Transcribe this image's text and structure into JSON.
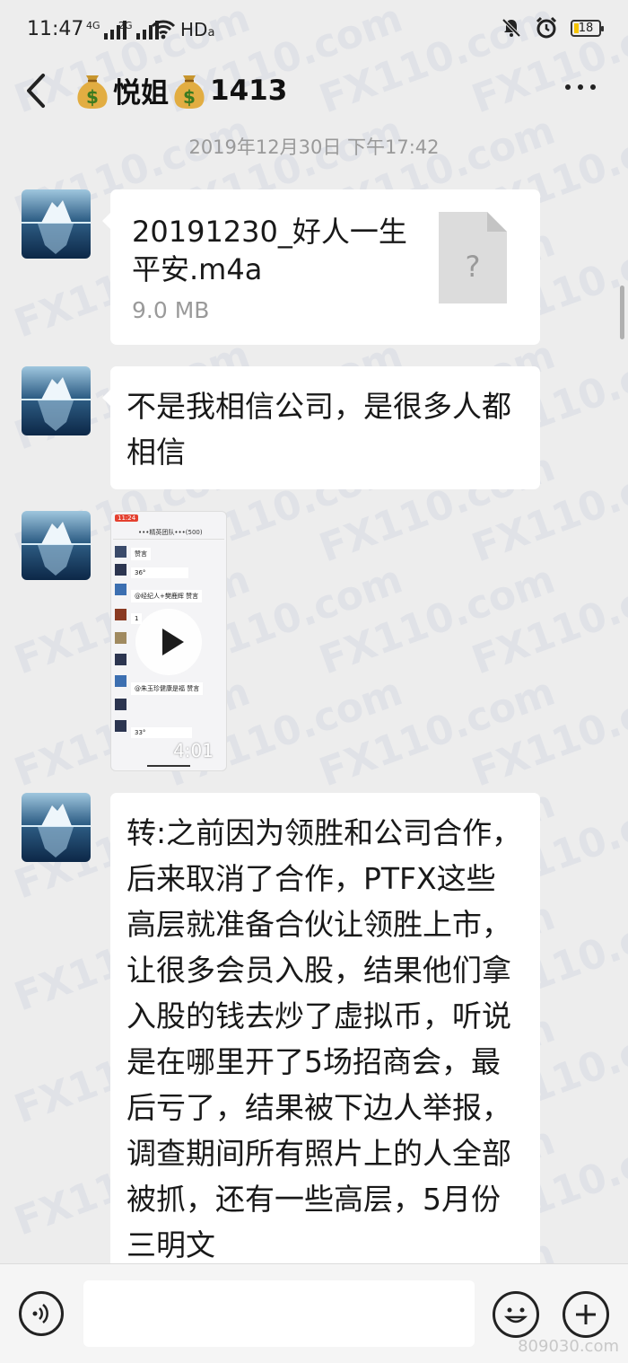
{
  "status_bar": {
    "time": "11:47",
    "signal1_label": "4G",
    "signal2_label": "2G",
    "network": "HD",
    "battery_level": "18",
    "icons": [
      "mute-icon",
      "alarm-icon",
      "wifi-icon",
      "battery-icon"
    ]
  },
  "header": {
    "title_name": "悦姐",
    "title_suffix": "1413",
    "title_emoji": "money-bag-icon",
    "back_icon": "chevron-left-icon",
    "more_icon": "more-dots-icon"
  },
  "chat": {
    "timestamp": "2019年12月30日 下午17:42",
    "messages": [
      {
        "type": "file",
        "file_name": "20191230_好人一生平安.m4a",
        "file_size": "9.0 MB",
        "icon": "unknown-file-icon"
      },
      {
        "type": "text",
        "text": "不是我相信公司，是很多人都相信"
      },
      {
        "type": "video",
        "duration": "4:01",
        "thumbnail": {
          "time": "11:24",
          "header": "•••精英团队•••(500)",
          "lines": [
            "赞言",
            "36°",
            "@经纪人+樊鹿辉 赞言",
            "1",
            "@朱玉珍健康是福 赞言",
            "33°"
          ]
        }
      },
      {
        "type": "text",
        "text": "转:之前因为领胜和公司合作，后来取消了合作，PTFX这些高层就准备合伙让领胜上市，让很多会员入股，结果他们拿入股的钱去炒了虚拟币，听说是在哪里开了5场招商会，最后亏了，结果被下边人举报，调查期间所有照片上的人全部被抓，还有一些高层，5月份三明文"
      }
    ]
  },
  "watermark": {
    "text": "FX110.com"
  },
  "footer_watermark": "809030.com",
  "input_bar": {
    "voice_icon": "voice-icon",
    "emoji_icon": "emoji-icon",
    "plus_icon": "plus-icon"
  }
}
